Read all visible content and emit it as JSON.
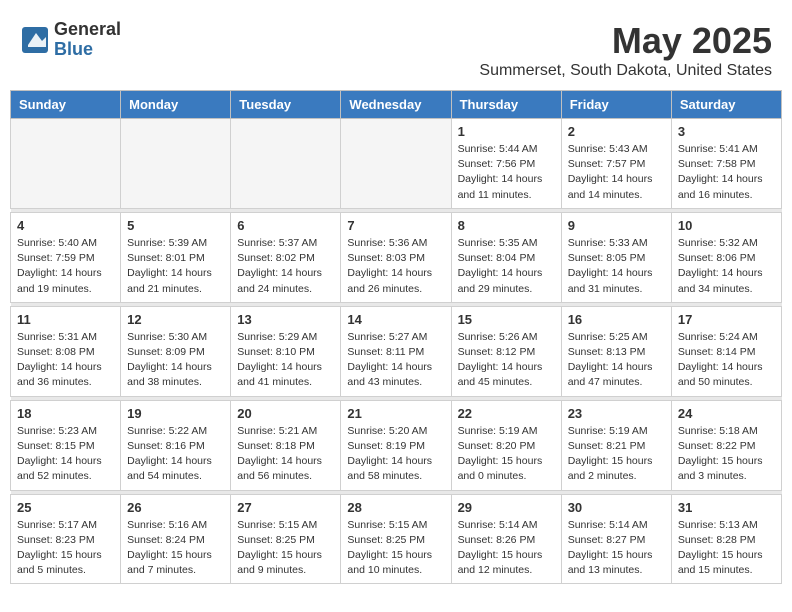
{
  "header": {
    "logo_general": "General",
    "logo_blue": "Blue",
    "month": "May 2025",
    "location": "Summerset, South Dakota, United States"
  },
  "days_of_week": [
    "Sunday",
    "Monday",
    "Tuesday",
    "Wednesday",
    "Thursday",
    "Friday",
    "Saturday"
  ],
  "weeks": [
    [
      {
        "day": "",
        "info": ""
      },
      {
        "day": "",
        "info": ""
      },
      {
        "day": "",
        "info": ""
      },
      {
        "day": "",
        "info": ""
      },
      {
        "day": "1",
        "info": "Sunrise: 5:44 AM\nSunset: 7:56 PM\nDaylight: 14 hours\nand 11 minutes."
      },
      {
        "day": "2",
        "info": "Sunrise: 5:43 AM\nSunset: 7:57 PM\nDaylight: 14 hours\nand 14 minutes."
      },
      {
        "day": "3",
        "info": "Sunrise: 5:41 AM\nSunset: 7:58 PM\nDaylight: 14 hours\nand 16 minutes."
      }
    ],
    [
      {
        "day": "4",
        "info": "Sunrise: 5:40 AM\nSunset: 7:59 PM\nDaylight: 14 hours\nand 19 minutes."
      },
      {
        "day": "5",
        "info": "Sunrise: 5:39 AM\nSunset: 8:01 PM\nDaylight: 14 hours\nand 21 minutes."
      },
      {
        "day": "6",
        "info": "Sunrise: 5:37 AM\nSunset: 8:02 PM\nDaylight: 14 hours\nand 24 minutes."
      },
      {
        "day": "7",
        "info": "Sunrise: 5:36 AM\nSunset: 8:03 PM\nDaylight: 14 hours\nand 26 minutes."
      },
      {
        "day": "8",
        "info": "Sunrise: 5:35 AM\nSunset: 8:04 PM\nDaylight: 14 hours\nand 29 minutes."
      },
      {
        "day": "9",
        "info": "Sunrise: 5:33 AM\nSunset: 8:05 PM\nDaylight: 14 hours\nand 31 minutes."
      },
      {
        "day": "10",
        "info": "Sunrise: 5:32 AM\nSunset: 8:06 PM\nDaylight: 14 hours\nand 34 minutes."
      }
    ],
    [
      {
        "day": "11",
        "info": "Sunrise: 5:31 AM\nSunset: 8:08 PM\nDaylight: 14 hours\nand 36 minutes."
      },
      {
        "day": "12",
        "info": "Sunrise: 5:30 AM\nSunset: 8:09 PM\nDaylight: 14 hours\nand 38 minutes."
      },
      {
        "day": "13",
        "info": "Sunrise: 5:29 AM\nSunset: 8:10 PM\nDaylight: 14 hours\nand 41 minutes."
      },
      {
        "day": "14",
        "info": "Sunrise: 5:27 AM\nSunset: 8:11 PM\nDaylight: 14 hours\nand 43 minutes."
      },
      {
        "day": "15",
        "info": "Sunrise: 5:26 AM\nSunset: 8:12 PM\nDaylight: 14 hours\nand 45 minutes."
      },
      {
        "day": "16",
        "info": "Sunrise: 5:25 AM\nSunset: 8:13 PM\nDaylight: 14 hours\nand 47 minutes."
      },
      {
        "day": "17",
        "info": "Sunrise: 5:24 AM\nSunset: 8:14 PM\nDaylight: 14 hours\nand 50 minutes."
      }
    ],
    [
      {
        "day": "18",
        "info": "Sunrise: 5:23 AM\nSunset: 8:15 PM\nDaylight: 14 hours\nand 52 minutes."
      },
      {
        "day": "19",
        "info": "Sunrise: 5:22 AM\nSunset: 8:16 PM\nDaylight: 14 hours\nand 54 minutes."
      },
      {
        "day": "20",
        "info": "Sunrise: 5:21 AM\nSunset: 8:18 PM\nDaylight: 14 hours\nand 56 minutes."
      },
      {
        "day": "21",
        "info": "Sunrise: 5:20 AM\nSunset: 8:19 PM\nDaylight: 14 hours\nand 58 minutes."
      },
      {
        "day": "22",
        "info": "Sunrise: 5:19 AM\nSunset: 8:20 PM\nDaylight: 15 hours\nand 0 minutes."
      },
      {
        "day": "23",
        "info": "Sunrise: 5:19 AM\nSunset: 8:21 PM\nDaylight: 15 hours\nand 2 minutes."
      },
      {
        "day": "24",
        "info": "Sunrise: 5:18 AM\nSunset: 8:22 PM\nDaylight: 15 hours\nand 3 minutes."
      }
    ],
    [
      {
        "day": "25",
        "info": "Sunrise: 5:17 AM\nSunset: 8:23 PM\nDaylight: 15 hours\nand 5 minutes."
      },
      {
        "day": "26",
        "info": "Sunrise: 5:16 AM\nSunset: 8:24 PM\nDaylight: 15 hours\nand 7 minutes."
      },
      {
        "day": "27",
        "info": "Sunrise: 5:15 AM\nSunset: 8:25 PM\nDaylight: 15 hours\nand 9 minutes."
      },
      {
        "day": "28",
        "info": "Sunrise: 5:15 AM\nSunset: 8:25 PM\nDaylight: 15 hours\nand 10 minutes."
      },
      {
        "day": "29",
        "info": "Sunrise: 5:14 AM\nSunset: 8:26 PM\nDaylight: 15 hours\nand 12 minutes."
      },
      {
        "day": "30",
        "info": "Sunrise: 5:14 AM\nSunset: 8:27 PM\nDaylight: 15 hours\nand 13 minutes."
      },
      {
        "day": "31",
        "info": "Sunrise: 5:13 AM\nSunset: 8:28 PM\nDaylight: 15 hours\nand 15 minutes."
      }
    ]
  ]
}
